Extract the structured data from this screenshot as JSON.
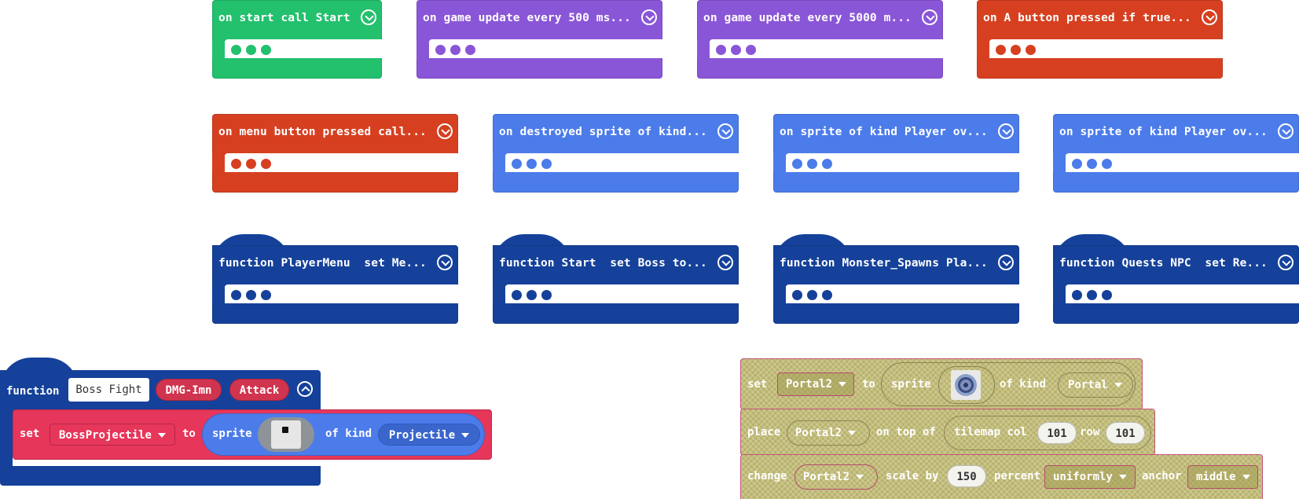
{
  "colors": {
    "green": "#23c06e",
    "purple": "#8a56d8",
    "red": "#d64020",
    "blue": "#4c7cea",
    "navy": "#15419a",
    "pink": "#e6365a",
    "sprite_blue": "#4c7cea",
    "olive": "#b8b269"
  },
  "events": [
    {
      "label": "on start call Start"
    },
    {
      "label": "on game update every 500 ms..."
    },
    {
      "label": "on game update every 5000 m..."
    },
    {
      "label": "on A button pressed if true..."
    },
    {
      "label": "on menu button pressed call..."
    },
    {
      "label": "on destroyed sprite of kind..."
    },
    {
      "label": "on sprite of kind Player ov..."
    },
    {
      "label": "on sprite of kind Player ov..."
    }
  ],
  "functions": [
    {
      "label": "function PlayerMenu  set Me..."
    },
    {
      "label": "function Start  set Boss to..."
    },
    {
      "label": "function Monster_Spawns Pla..."
    },
    {
      "label": "function Quests NPC  set Re..."
    }
  ],
  "boss_function": {
    "keyword": "function",
    "name": "Boss Fight",
    "params": [
      "DMG-Imn",
      "Attack"
    ],
    "stmt": {
      "set": "set",
      "variable": "BossProjectile",
      "to": "to",
      "sprite": "sprite",
      "of_kind": "of kind",
      "kind": "Projectile"
    }
  },
  "portal_stack": {
    "row1": {
      "set": "set",
      "variable": "Portal2",
      "to": "to",
      "sprite": "sprite",
      "of_kind": "of kind",
      "kind": "Portal"
    },
    "row2": {
      "place": "place",
      "variable": "Portal2",
      "on_top_of": "on top of",
      "tilemap_col": "tilemap col",
      "col": "101",
      "row_label": "row",
      "row": "101"
    },
    "row3": {
      "change": "change",
      "variable": "Portal2",
      "scale_by": "scale by",
      "amount": "150",
      "percent": "percent",
      "mode": "uniformly",
      "anchor": "anchor",
      "anchor_value": "middle"
    }
  }
}
